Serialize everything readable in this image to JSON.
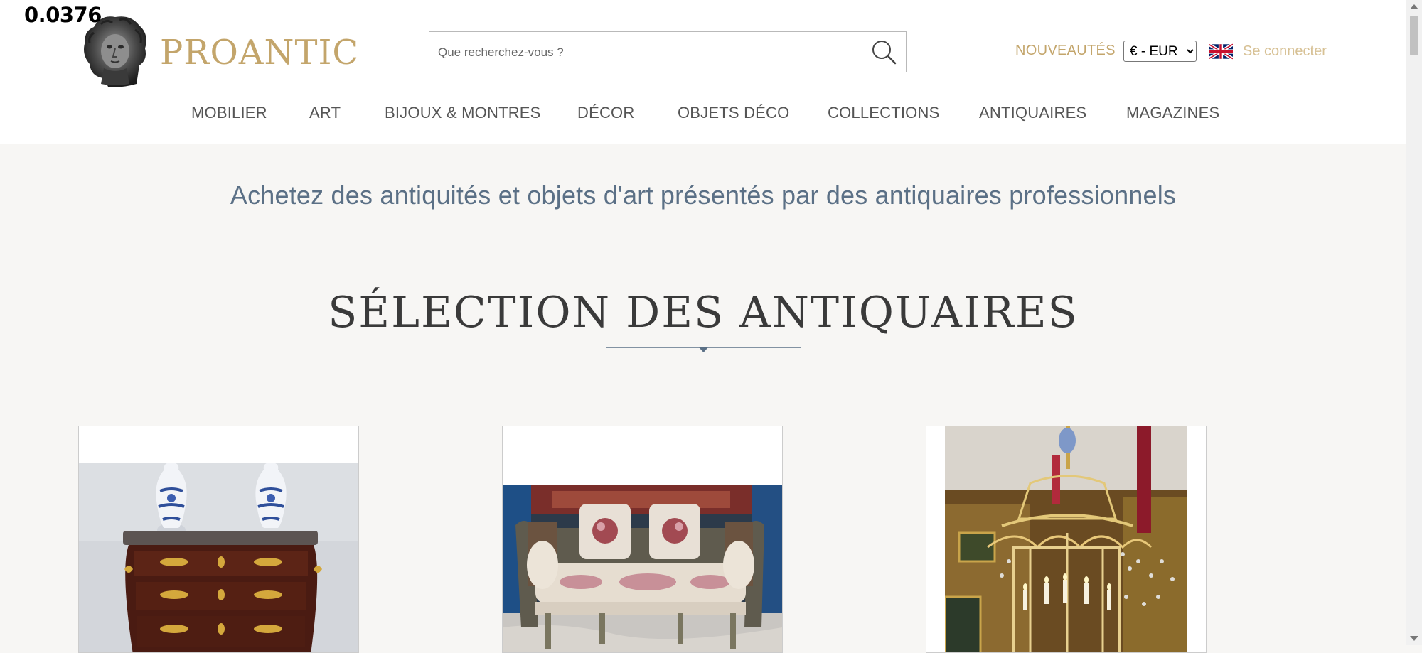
{
  "overlay": {
    "value": "0.0376"
  },
  "header": {
    "brand": "PROANTIC",
    "search": {
      "placeholder": "Que recherchez-vous ?",
      "value": ""
    },
    "nouveautes": "NOUVEAUTÉS",
    "currency": {
      "selected": "€ - EUR",
      "options": [
        "€ - EUR"
      ]
    },
    "language_icon": "uk-flag-icon",
    "connect": "Se connecter"
  },
  "nav": {
    "items": [
      {
        "label": "MOBILIER"
      },
      {
        "label": "ART"
      },
      {
        "label": "BIJOUX & MONTRES"
      },
      {
        "label": "DÉCOR"
      },
      {
        "label": "OBJETS DÉCO"
      },
      {
        "label": "COLLECTIONS"
      },
      {
        "label": "ANTIQUAIRES"
      },
      {
        "label": "MAGAZINES"
      }
    ]
  },
  "main": {
    "tagline": "Achetez des antiquités et objets d'art présentés par des antiquaires professionnels",
    "section_title": "SÉLECTION DES ANTIQUAIRES"
  },
  "colors": {
    "brand_gold": "#c3a56b",
    "link_gold_light": "#d7c195",
    "slate_blue": "#5b7086",
    "page_bg": "#f7f6f4"
  }
}
